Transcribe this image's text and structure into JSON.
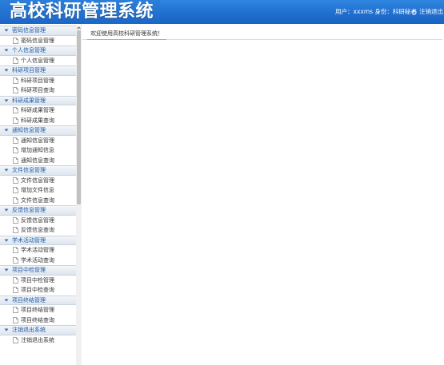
{
  "header": {
    "app_title": "高校科研管理系统",
    "user_info": "用户：xxxms 身份：科研秘书",
    "logout_label": "注销退出"
  },
  "sidebar": {
    "groups": [
      {
        "label": "密码信息管理",
        "items": [
          {
            "label": "密码信息管理"
          }
        ]
      },
      {
        "label": "个人信息管理",
        "items": [
          {
            "label": "个人信息管理"
          }
        ]
      },
      {
        "label": "科研项目管理",
        "items": [
          {
            "label": "科研项目管理"
          },
          {
            "label": "科研项目查询"
          }
        ]
      },
      {
        "label": "科研成果管理",
        "items": [
          {
            "label": "科研成果管理"
          },
          {
            "label": "科研成果查询"
          }
        ]
      },
      {
        "label": "通知信息管理",
        "items": [
          {
            "label": "通知信息管理"
          },
          {
            "label": "增加通知信息"
          },
          {
            "label": "通知信息查询"
          }
        ]
      },
      {
        "label": "文件信息管理",
        "items": [
          {
            "label": "文件信息管理"
          },
          {
            "label": "增加文件信息"
          },
          {
            "label": "文件信息查询"
          }
        ]
      },
      {
        "label": "反馈信息管理",
        "items": [
          {
            "label": "反馈信息管理"
          },
          {
            "label": "反馈信息查询"
          }
        ]
      },
      {
        "label": "学术活动管理",
        "items": [
          {
            "label": "学术活动管理"
          },
          {
            "label": "学术活动查询"
          }
        ]
      },
      {
        "label": "项目中检管理",
        "items": [
          {
            "label": "项目中检管理"
          },
          {
            "label": "项目中检查询"
          }
        ]
      },
      {
        "label": "项目终结管理",
        "items": [
          {
            "label": "项目终结管理"
          },
          {
            "label": "项目终结查询"
          }
        ]
      },
      {
        "label": "注销退出系统",
        "items": [
          {
            "label": "注销退出系统"
          }
        ]
      }
    ]
  },
  "main": {
    "tab_label": "欢迎使用高校科研管理系统！"
  },
  "colors": {
    "header_blue": "#1f6fcf",
    "group_text": "#1c5aa8",
    "tab_underline": "#f0a048"
  }
}
